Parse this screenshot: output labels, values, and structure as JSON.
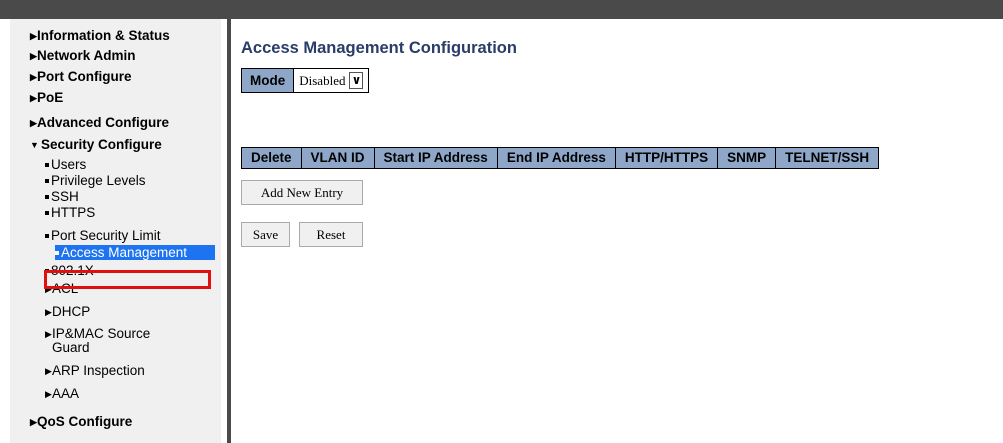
{
  "sidebar": {
    "items": [
      {
        "label": "Information & Status"
      },
      {
        "label": "Network Admin"
      },
      {
        "label": "Port Configure"
      },
      {
        "label": "PoE"
      },
      {
        "label": "Advanced Configure"
      },
      {
        "label": "Security Configure"
      },
      {
        "label": "QoS Configure"
      }
    ],
    "security_sub": [
      {
        "label": "Users"
      },
      {
        "label": "Privilege Levels"
      },
      {
        "label": "SSH"
      },
      {
        "label": "HTTPS"
      },
      {
        "label": "Port Security Limit"
      },
      {
        "label": "Access Management"
      },
      {
        "label": "802.1X"
      },
      {
        "label": "ACL"
      },
      {
        "label": "DHCP"
      },
      {
        "label": "IP&MAC Source"
      },
      {
        "label": "Guard"
      },
      {
        "label": "ARP Inspection"
      },
      {
        "label": "AAA"
      }
    ]
  },
  "main": {
    "title": "Access Management Configuration",
    "mode_label": "Mode",
    "mode_value": "Disabled",
    "columns": [
      "Delete",
      "VLAN ID",
      "Start IP Address",
      "End IP Address",
      "HTTP/HTTPS",
      "SNMP",
      "TELNET/SSH"
    ],
    "add_button": "Add New Entry",
    "save_button": "Save",
    "reset_button": "Reset"
  },
  "colors": {
    "topbar": "#4a4a4a",
    "sidebar_bg": "#f0f0f0",
    "header_bg": "#8ea7c8",
    "title_color": "#2a3c68",
    "active_bg": "#1e74f0",
    "highlight_border": "#e01010"
  },
  "icons": {
    "collapsed": "triangle-right-icon",
    "expanded": "triangle-down-icon",
    "leaf": "square-bullet-icon",
    "dropdown": "chevron-down-icon"
  }
}
